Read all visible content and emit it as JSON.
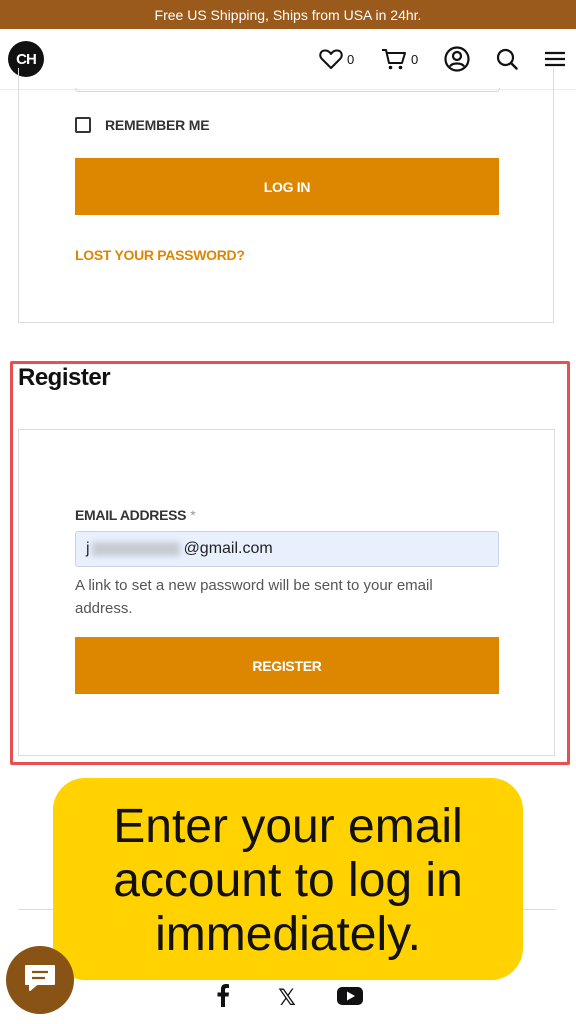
{
  "announcement": "Free US Shipping, Ships from USA in 24hr.",
  "header": {
    "logo_text": "CH",
    "wishlist_count": "0",
    "cart_count": "0",
    "icons": [
      "heart-icon",
      "cart-icon",
      "account-icon",
      "search-icon",
      "menu-icon"
    ]
  },
  "login": {
    "remember_label": "REMEMBER ME",
    "login_button": "LOG IN",
    "lost_password": "LOST YOUR PASSWORD?"
  },
  "register": {
    "title": "Register",
    "email_label": "EMAIL ADDRESS",
    "required_mark": "*",
    "email_value_start": "j",
    "email_value_end": "@gmail.com",
    "help_text": "A link to set a new password will be sent to your email address.",
    "register_button": "REGISTER"
  },
  "callout": {
    "text": "Enter your email account to log in immediately."
  },
  "footer": {
    "social_icons": [
      "facebook-icon",
      "x-icon",
      "youtube-icon"
    ],
    "x_glyph": "𝕏"
  },
  "colors": {
    "accent": "#dd8600",
    "topbar": "#9a5a1c",
    "highlight": "#e85050",
    "callout": "#ffd200"
  }
}
